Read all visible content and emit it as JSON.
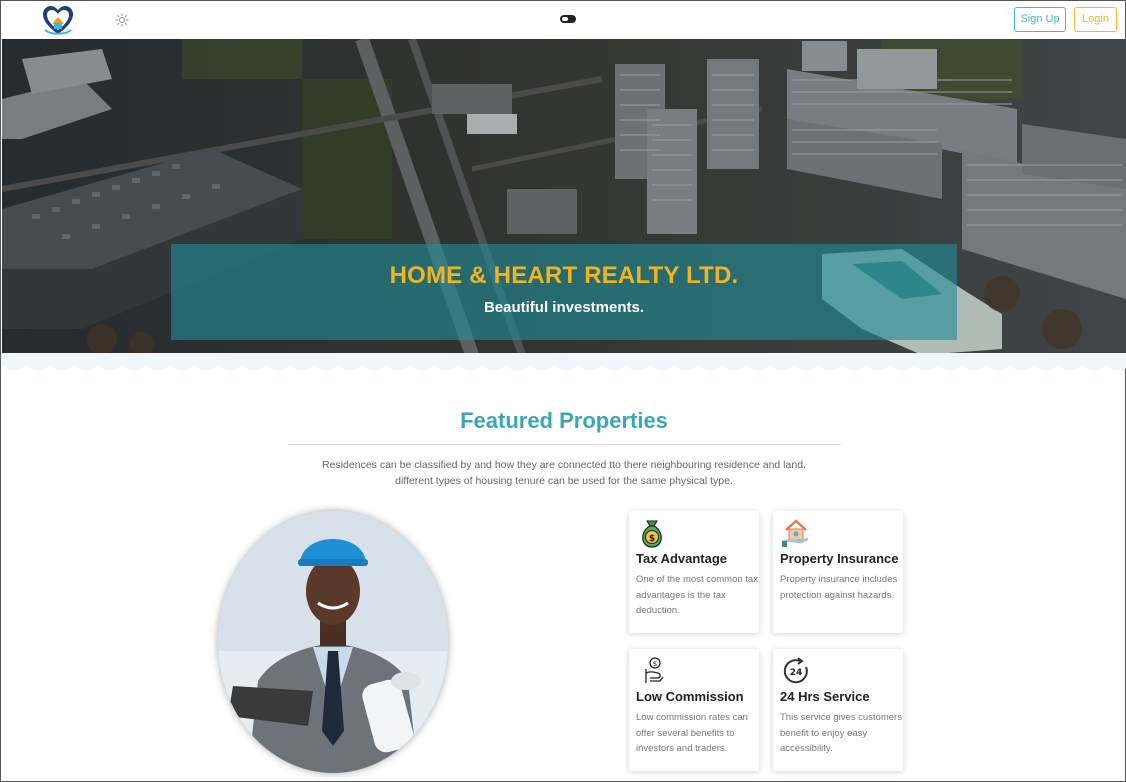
{
  "nav": {
    "signup_label": "Sign Up",
    "login_label": "Login",
    "logo_icon": "house-heart-logo-icon",
    "theme_icon": "sun-icon",
    "toggle_icon": "toggle-switch-icon"
  },
  "hero": {
    "title": "HOME & HEART REALTY LTD.",
    "subtitle": "Beautiful investments."
  },
  "featured": {
    "title": "Featured Properties",
    "description_line1": "Residences can be classified by and how they are connected tto there neighbouring residence and land.",
    "description_line2": "different types of housing tenure can be used for the same physical type."
  },
  "cards": [
    {
      "title": "Tax Advantage",
      "text": "One of the most common tax advantages is the tax deduction.",
      "icon": "money-bag-icon"
    },
    {
      "title": "Property Insurance",
      "text": "Property insurance includes protection against hazards.",
      "icon": "house-hand-icon"
    },
    {
      "title": "Low Commission",
      "text": "Low commission rates can offer several benefits to investors and traders.",
      "icon": "hand-coin-icon"
    },
    {
      "title": "24 Hrs Service",
      "text": "This service gives customers benefit to enjoy easy accessibility.",
      "icon": "clock-24-icon"
    }
  ],
  "colors": {
    "accent_teal": "#3aa7b5",
    "accent_gold": "#f2b320",
    "signup_border": "#3fb7d6",
    "login_border": "#f0b528"
  }
}
